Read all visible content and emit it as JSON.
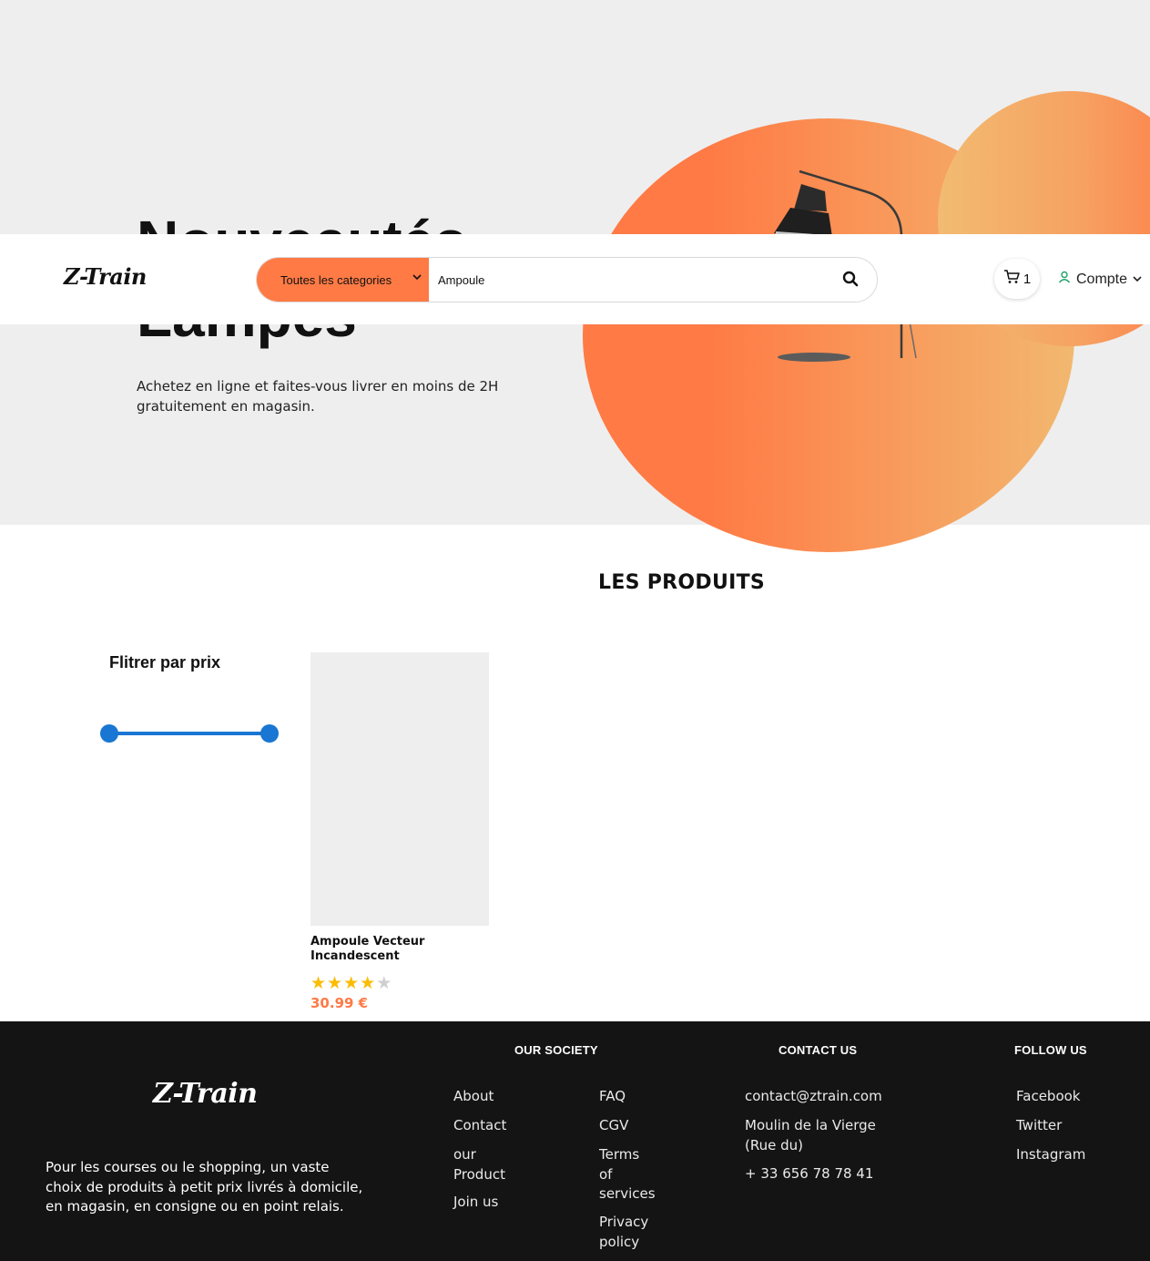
{
  "hero": {
    "title_line1": "Nouveautés",
    "title_line2": "Lampes",
    "description": "Achetez en ligne et faites-vous livrer en moins de 2H gratuitement en magasin."
  },
  "header": {
    "logo": "Z-Train",
    "search": {
      "category_label": "Toutes les categories",
      "value": "Ampoule",
      "search_icon": "search-icon"
    },
    "cart": {
      "icon": "cart-icon",
      "count": "1"
    },
    "account": {
      "icon": "user-icon",
      "label": "Compte"
    }
  },
  "products": {
    "section_title": "LES PRODUITS",
    "filter_title": "Flitrer par prix",
    "price_range": [
      0,
      1
    ],
    "items": [
      {
        "name": "Ampoule Vecteur Incandescent",
        "rating": 4,
        "rating_max": 5,
        "price": "30.99 €"
      }
    ]
  },
  "footer": {
    "logo": "Z-Train",
    "description": "Pour les courses ou le shopping, un vaste choix de produits à petit prix livrés à domicile, en magasin, en consigne ou en point relais.",
    "society": {
      "heading": "OUR SOCIETY",
      "col1": [
        "About",
        "Contact",
        "our Product",
        "Join us"
      ],
      "col2": [
        "FAQ",
        "CGV",
        "Terms of services",
        "Privacy policy"
      ]
    },
    "contact": {
      "heading": "CONTACT US",
      "email": "contact@ztrain.com",
      "address": "Moulin de la Vierge (Rue du)",
      "phone": "+ 33 656 78 78 41"
    },
    "follow": {
      "heading": "FOLLOW US",
      "links": [
        "Facebook",
        "Twitter",
        "Instagram"
      ]
    }
  },
  "colors": {
    "accent": "#ff7a45",
    "star": "#fbbc04",
    "slider": "#1976d2",
    "footer_bg": "#141414"
  }
}
